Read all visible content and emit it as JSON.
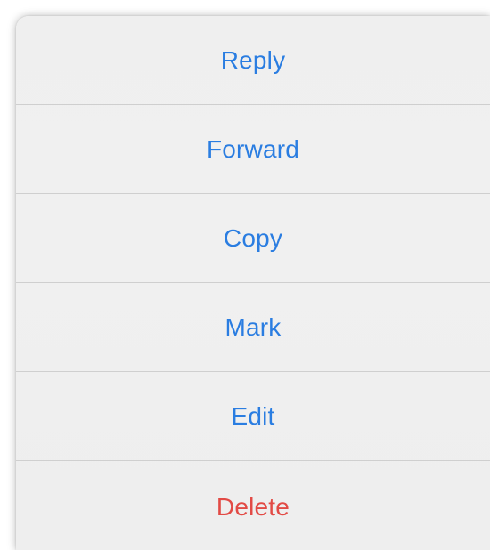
{
  "menu": {
    "items": [
      {
        "label": "Reply",
        "style": "default"
      },
      {
        "label": "Forward",
        "style": "default"
      },
      {
        "label": "Copy",
        "style": "default"
      },
      {
        "label": "Mark",
        "style": "default"
      },
      {
        "label": "Edit",
        "style": "default"
      },
      {
        "label": "Delete",
        "style": "destructive"
      }
    ]
  },
  "colors": {
    "action": "#2a7de1",
    "destructive": "#e24a45",
    "background": "#efefef",
    "separator": "#cfcfcf"
  }
}
